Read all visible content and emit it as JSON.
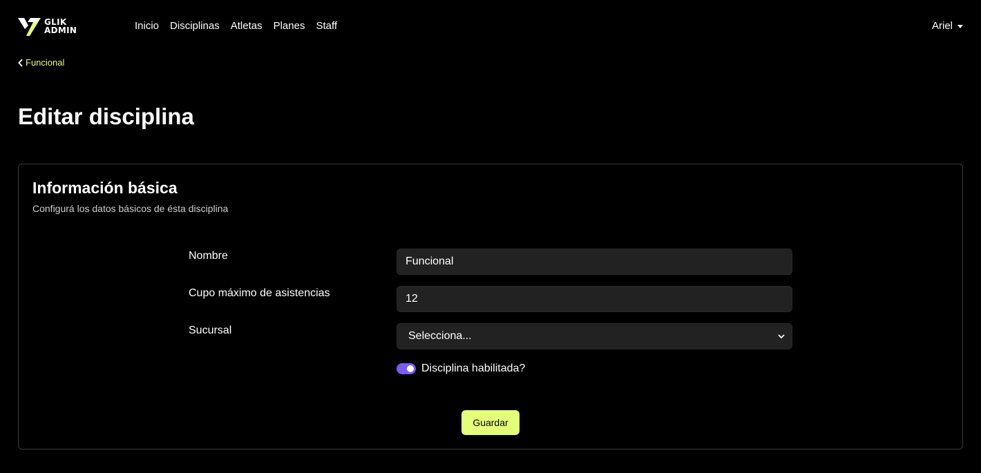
{
  "app": {
    "logo_line1": "GLIK",
    "logo_line2": "ADMIN",
    "accent_color": "#e4ff7a",
    "toggle_color": "#7b5bf2"
  },
  "nav": {
    "links": [
      {
        "label": "Inicio"
      },
      {
        "label": "Disciplinas"
      },
      {
        "label": "Atletas"
      },
      {
        "label": "Planes"
      },
      {
        "label": "Staff"
      }
    ],
    "user_label": "Ariel",
    "user_icon": "caret-down-icon"
  },
  "breadcrumb": {
    "back_label": "Funcional",
    "back_icon": "chevron-left-icon"
  },
  "page": {
    "title": "Editar disciplina"
  },
  "card": {
    "title": "Información básica",
    "subtitle": "Configurá los datos básicos de ésta disciplina"
  },
  "form": {
    "name_label": "Nombre",
    "name_value": "Funcional",
    "capacity_label": "Cupo máximo de asistencias",
    "capacity_value": "12",
    "branch_label": "Sucursal",
    "branch_selected": "Selecciona...",
    "enabled_label": "Disciplina habilitada?",
    "enabled_value": true,
    "save_label": "Guardar"
  }
}
